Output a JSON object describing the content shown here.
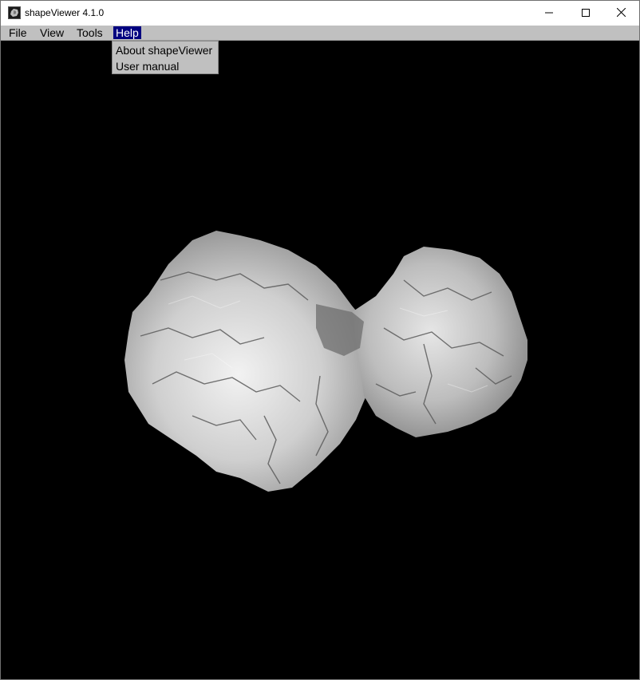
{
  "window": {
    "title": "shapeViewer 4.1.0",
    "app_icon": "comet-cube-icon",
    "controls": [
      "minimize-icon",
      "maximize-icon",
      "close-icon"
    ]
  },
  "menubar": {
    "items": [
      {
        "label": "File"
      },
      {
        "label": "View"
      },
      {
        "label": "Tools"
      },
      {
        "label": "Help",
        "active": true
      }
    ]
  },
  "help_menu": {
    "items": [
      {
        "label": "About shapeViewer"
      },
      {
        "label": "User manual"
      }
    ]
  },
  "viewport": {
    "background": "#000000",
    "content": "3d-model"
  }
}
